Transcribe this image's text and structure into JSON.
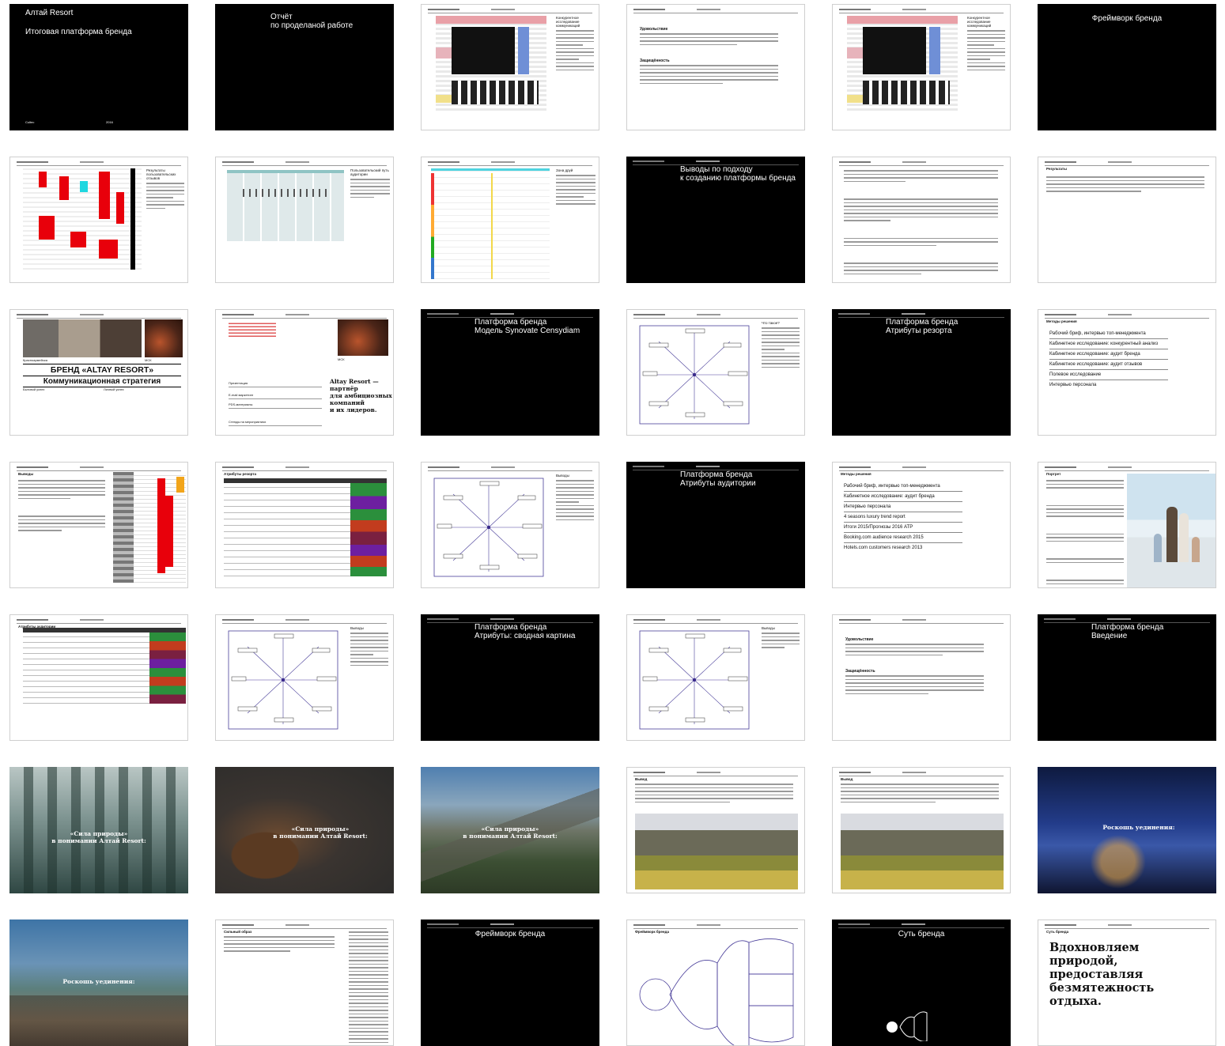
{
  "slides": [
    {
      "title": "Алтай Resort",
      "subtitle": "Итоговая платформа бренда",
      "footer_left": "Cultec",
      "footer_right": "2016"
    },
    {
      "title": "Отчёт\nпо проделаной работе"
    },
    {
      "heading": "Конкурентное исследование коммуникаций"
    },
    {
      "section1": "Удовольствие",
      "section2": "Защищённость"
    },
    {
      "heading": "Конкурентное исследование коммуникаций"
    },
    {
      "title": "Фреймворк бренда"
    },
    {
      "heading": "Результаты пользовательских отзывов"
    },
    {
      "heading": "Пользовательский путь аудитории"
    },
    {
      "heading": "Зона друй"
    },
    {
      "title": "Выводы по подходу\nк созданию платформы бренда"
    },
    {
      "kind": "text"
    },
    {
      "heading": "Результаты"
    },
    {
      "caption_left": "Красноармейска",
      "caption_right": "МСК",
      "headline": "БРЕНД «ALTAY RESORT»",
      "subheadline": "Коммуникационная стратегия",
      "row_left": "Бытовой успех",
      "row_right": "Личный успех"
    },
    {
      "caption_right": "МСК",
      "lines": [
        "Презентация",
        "E-mail маркетинг",
        "PDS-материалы",
        "Стенды на мероприятиях"
      ],
      "quote": "Altay Resort —\nпартнёр\nдля амбициозных\nкомпаний\nи их лидеров."
    },
    {
      "title": "Платформа бренда",
      "subtitle": "Модель Synovate Censydiam"
    },
    {
      "heading": "Что такое?",
      "nodes": [
        "Принадлежность",
        "Уважение",
        "Признание",
        "Превосходство",
        "Власть",
        "Уверенность",
        "Контроль",
        "Поощрение"
      ]
    },
    {
      "title": "Платформа бренда",
      "subtitle": "Атрибуты резорта"
    },
    {
      "heading": "Методы решения",
      "items": [
        "Рабочий бриф, интервью топ-менеджмента",
        "Кабинетное исследование: конкурентный анализ",
        "Кабинетное исследование: аудит бренда",
        "Кабинетное исследование: аудит отзывов",
        "Полевое исследование",
        "Интервью персонала"
      ]
    },
    {
      "heading": "Выводы"
    },
    {
      "heading": "Атрибуты резорта"
    },
    {
      "heading": "Выводы"
    },
    {
      "title": "Платформа бренда",
      "subtitle": "Атрибуты аудитории"
    },
    {
      "heading": "Методы решения",
      "items": [
        "Рабочий бриф, интервью топ-менеджмента",
        "Кабинетное исследование: аудит бренда",
        "Интервью персонала",
        "4 seasons luxury trend report",
        "Итоги 2015/Прогнозы 2016 АТР",
        "Booking.com audience research 2015",
        "Hotels.com customers research 2013"
      ]
    },
    {
      "heading": "Портрет"
    },
    {
      "heading": "Атрибуты аудитории"
    },
    {
      "heading": "Выводы"
    },
    {
      "title": "Платформа бренда",
      "subtitle": "Атрибуты: сводная картина"
    },
    {
      "heading": "Выводы"
    },
    {
      "section1": "Удовольствие",
      "section2": "Защищённость"
    },
    {
      "title": "Платформа бренда",
      "subtitle": "Введение"
    },
    {
      "caption": "«Сила природы»\nв понимании Алтай Resort:"
    },
    {
      "caption": "«Сила природы»\nв понимании Алтай Resort:"
    },
    {
      "caption": "«Сила природы»\nв понимании Алтай Resort:"
    },
    {
      "heading": "Вывод"
    },
    {
      "heading": "Вывод"
    },
    {
      "caption": "Роскошь уединения:"
    },
    {
      "caption": "Роскошь уединения:"
    },
    {
      "heading": "Сильный образ"
    },
    {
      "title": "Фреймворк бренда"
    },
    {
      "heading": "Фреймворк бренда"
    },
    {
      "title": "Суть бренда"
    },
    {
      "heading": "Суть бренда",
      "tagline": "Вдохновляем\nприродой,\nпредоставляя\nбезмятежность\nотдыха."
    }
  ],
  "colors": {
    "dark": "#000000",
    "accent_red": "#e8000b",
    "accent_purple": "#3b2b8c",
    "radial_stroke": "#4a3f9a"
  }
}
